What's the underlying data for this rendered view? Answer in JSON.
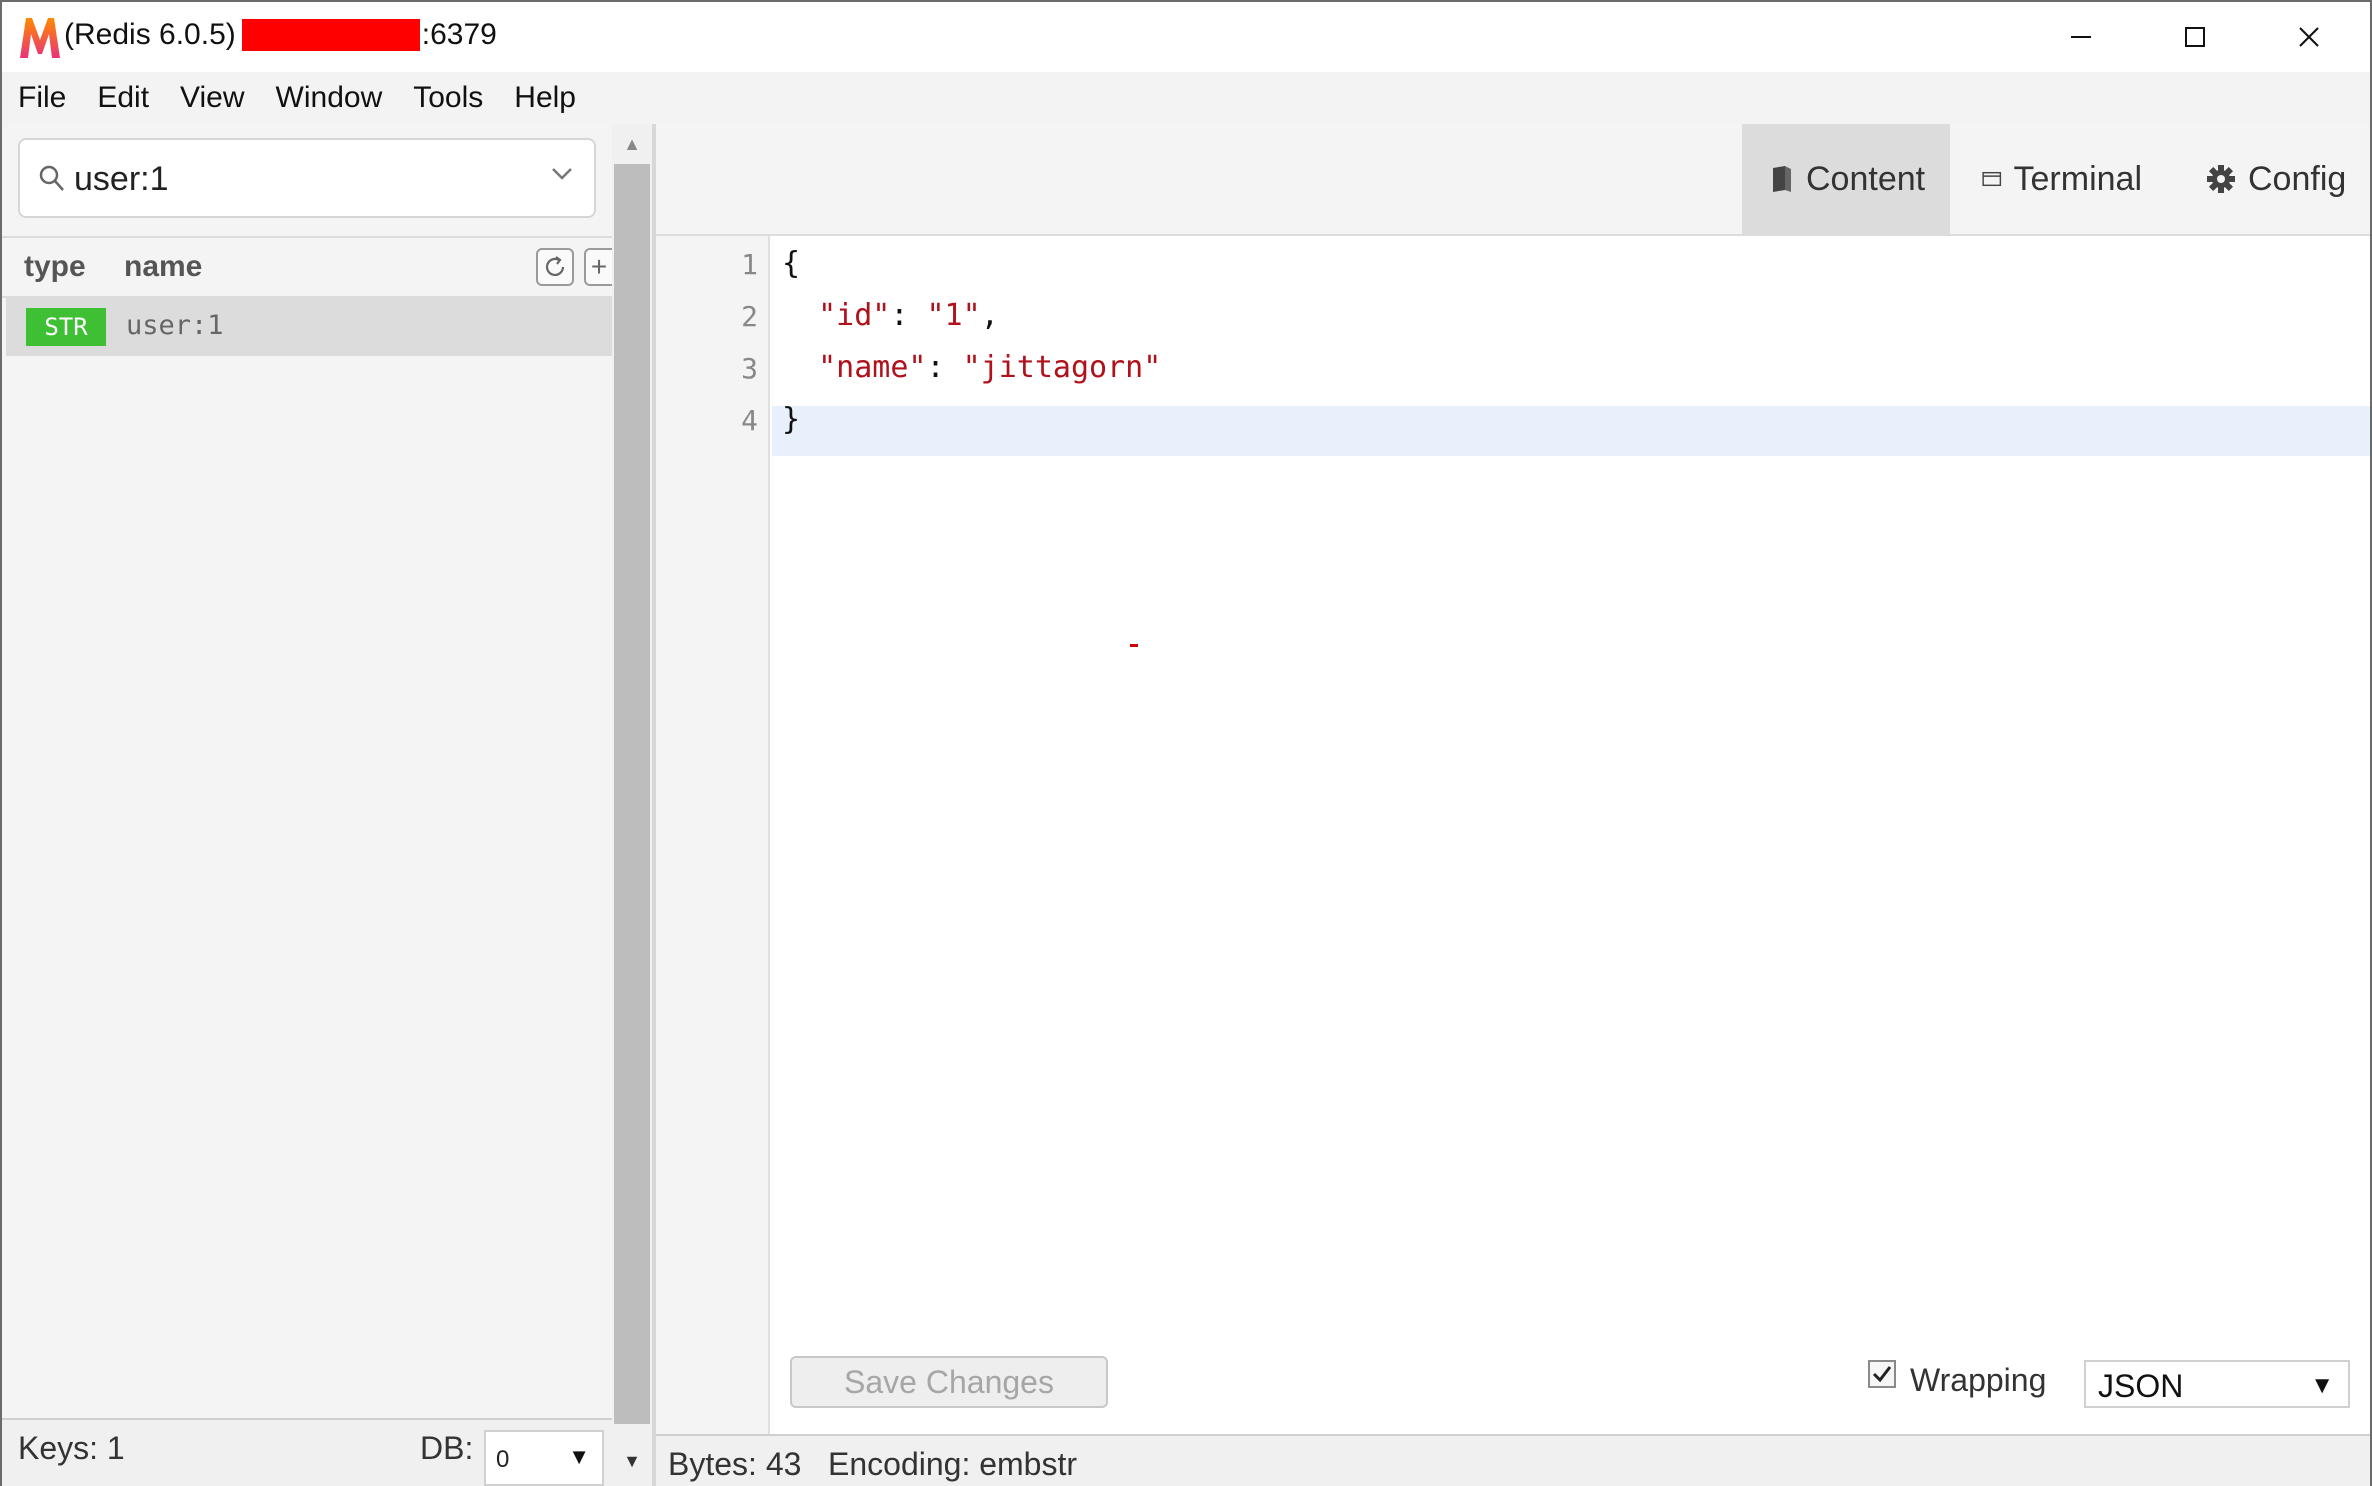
{
  "window": {
    "title_prefix": "(Redis 6.0.5)",
    "title_port": ":6379"
  },
  "menu": [
    "File",
    "Edit",
    "View",
    "Window",
    "Tools",
    "Help"
  ],
  "search": {
    "value": "user:1"
  },
  "key_list": {
    "columns": {
      "type": "type",
      "name": "name"
    },
    "add_label": "+",
    "rows": [
      {
        "type": "STR",
        "name": "user:1",
        "type_color": "#3fbf34"
      }
    ]
  },
  "left_status": {
    "keys": "Keys: 1",
    "db_label": "DB:",
    "db_value": "0",
    "db_arrow": "▼"
  },
  "tabs": {
    "content": "Content",
    "terminal": "Terminal",
    "config": "Config"
  },
  "editor": {
    "line_numbers": [
      "1",
      "2",
      "3",
      "4"
    ],
    "lines": {
      "l1": "{",
      "l2_key": "\"id\"",
      "l2_sep": ": ",
      "l2_val": "\"1\"",
      "l2_end": ",",
      "l3_key": "\"name\"",
      "l3_sep": ": ",
      "l3_val": "\"jittagorn\"",
      "l4": "}"
    },
    "string_color": "#b0121c"
  },
  "footer": {
    "save_label": "Save Changes",
    "wrapping_label": "Wrapping",
    "wrapping_checked": true,
    "format_value": "JSON",
    "format_arrow": "▼"
  },
  "right_status": {
    "bytes": "Bytes: 43",
    "encoding": "Encoding: embstr"
  },
  "icons": {
    "app": "medis-logo-icon",
    "search": "search-icon",
    "chevron": "chevron-down-icon",
    "refresh": "refresh-icon",
    "content": "book-icon",
    "terminal": "terminal-window-icon",
    "config": "gear-icon"
  }
}
